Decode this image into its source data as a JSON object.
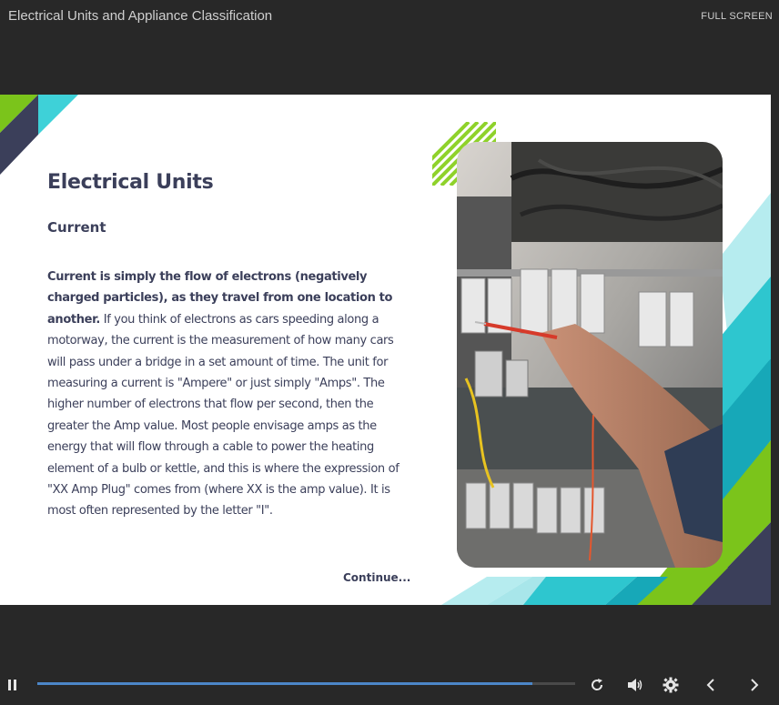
{
  "header": {
    "course_title": "Electrical Units and Appliance Classification",
    "fullscreen_label": "FULL SCREEN"
  },
  "slide": {
    "heading": "Electrical Units",
    "subheading": "Current",
    "body_bold": "Current is simply the flow of electrons (negatively charged particles), as they travel from one location to another.",
    "body_rest": " If you think of electrons as cars speeding along a motorway, the current is the measurement of how many cars will pass under a bridge in a set amount of time. The unit for measuring a current is \"Ampere\" or just simply \"Amps\". The higher number of electrons that flow per second, then the greater the Amp value. Most people envisage amps as the energy that will flow through a cable to power the heating element of a bulb or kettle, and this is where the expression of \"XX Amp Plug\" comes from (where XX is the amp value). It is most often represented by the letter \"I\".",
    "continue_label": "Continue..."
  },
  "player": {
    "progress_fraction": 0.92,
    "icons": [
      "pause-icon",
      "replay-icon",
      "volume-icon",
      "settings-icon",
      "previous-icon",
      "next-icon"
    ]
  },
  "colors": {
    "background": "#282828",
    "navy": "#3b3f5a",
    "teal": "#2ec6cf",
    "light_teal": "#a8e6ea",
    "green": "#7bc41b",
    "progress": "#4c86c8"
  }
}
